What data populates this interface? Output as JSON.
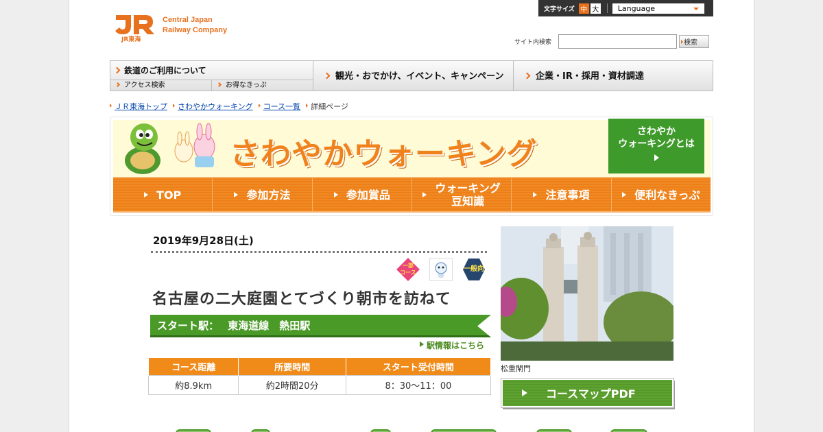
{
  "header": {
    "logo_text_1": "Central Japan",
    "logo_text_2": "Railway Company",
    "logo_sub": "JR東海"
  },
  "util": {
    "font_size_label": "文字サイズ",
    "font_mid": "中",
    "font_big": "大",
    "language": "Language"
  },
  "search": {
    "label": "サイト内検索",
    "value": "",
    "button": "検索"
  },
  "global_nav": {
    "rail": "鉄道のご利用について",
    "access": "アクセス検索",
    "tickets": "お得なきっぷ",
    "tourism": "観光・おでかけ、イベント、キャンペーン",
    "corporate": "企業・IR・採用・資材調達"
  },
  "breadcrumb": [
    "ＪＲ東海トップ",
    "さわやかウォーキング",
    "コース一覧",
    "詳細ページ"
  ],
  "banner": {
    "title": "さわやかウォーキング",
    "about_1": "さわやか",
    "about_2": "ウォーキングとは",
    "nav": [
      {
        "label": "TOP"
      },
      {
        "label": "参加方法"
      },
      {
        "label": "参加賞品"
      },
      {
        "label_1": "ウォーキング",
        "label_2": "豆知識"
      },
      {
        "label": "注意事項"
      },
      {
        "label": "便利なきっぷ"
      }
    ]
  },
  "course": {
    "date": "2019年9月28日(土)",
    "badges": [
      "一部 コース",
      "",
      "一般向"
    ],
    "title": "名古屋の二大庭園とてづくり朝市を訪ねて",
    "start_label": "スタート駅：",
    "start_station": "東海道線　熱田駅",
    "station_link": "駅情報はこちら",
    "table": {
      "headers": [
        "コース距離",
        "所要時間",
        "スタート受付時間"
      ],
      "values": [
        "約8.9km",
        "約2時間20分",
        "8：30～11：00"
      ]
    },
    "photo_caption": "松重閘門",
    "pdf_button": "コースマップPDF"
  },
  "colors": {
    "accent_orange": "#e8711e",
    "green": "#4a9a28",
    "navy": "#26466e"
  }
}
